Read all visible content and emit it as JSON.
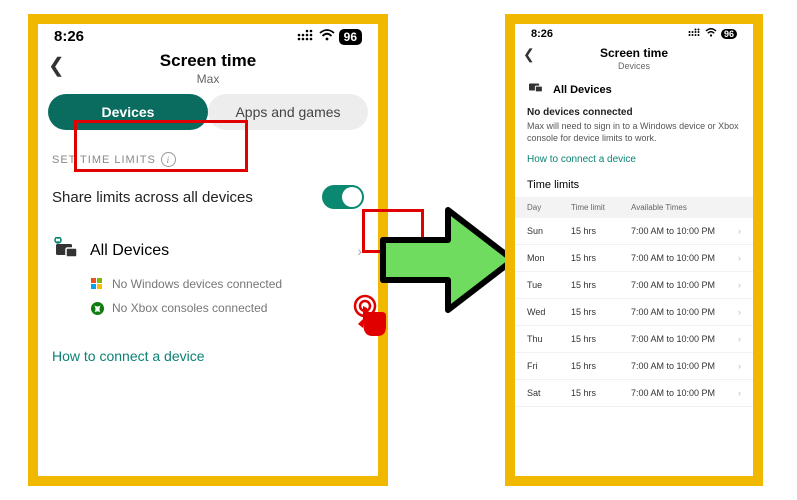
{
  "status": {
    "time": "8:26",
    "signal": "::::",
    "wifi": "wifi",
    "battery": "96"
  },
  "left": {
    "title": "Screen time",
    "subtitle": "Max",
    "tabs": {
      "devices": "Devices",
      "apps": "Apps and games"
    },
    "section_label": "SET TIME LIMITS",
    "share_label": "Share limits across all devices",
    "all_devices": "All Devices",
    "no_windows": "No Windows devices connected",
    "no_xbox": "No Xbox consoles connected",
    "how_link": "How to connect a device"
  },
  "right": {
    "title": "Screen time",
    "subtitle": "Devices",
    "all_devices": "All Devices",
    "nd_title": "No devices connected",
    "nd_body": "Max will need to sign in to a Windows device or Xbox console for device limits to work.",
    "how_link": "How to connect a device",
    "tl_title": "Time limits",
    "headers": {
      "day": "Day",
      "limit": "Time limit",
      "avail": "Available Times"
    },
    "rows": [
      {
        "day": "Sun",
        "limit": "15 hrs",
        "avail": "7:00 AM to 10:00 PM"
      },
      {
        "day": "Mon",
        "limit": "15 hrs",
        "avail": "7:00 AM to 10:00 PM"
      },
      {
        "day": "Tue",
        "limit": "15 hrs",
        "avail": "7:00 AM to 10:00 PM"
      },
      {
        "day": "Wed",
        "limit": "15 hrs",
        "avail": "7:00 AM to 10:00 PM"
      },
      {
        "day": "Thu",
        "limit": "15 hrs",
        "avail": "7:00 AM to 10:00 PM"
      },
      {
        "day": "Fri",
        "limit": "15 hrs",
        "avail": "7:00 AM to 10:00 PM"
      },
      {
        "day": "Sat",
        "limit": "15 hrs",
        "avail": "7:00 AM to 10:00 PM"
      }
    ]
  }
}
